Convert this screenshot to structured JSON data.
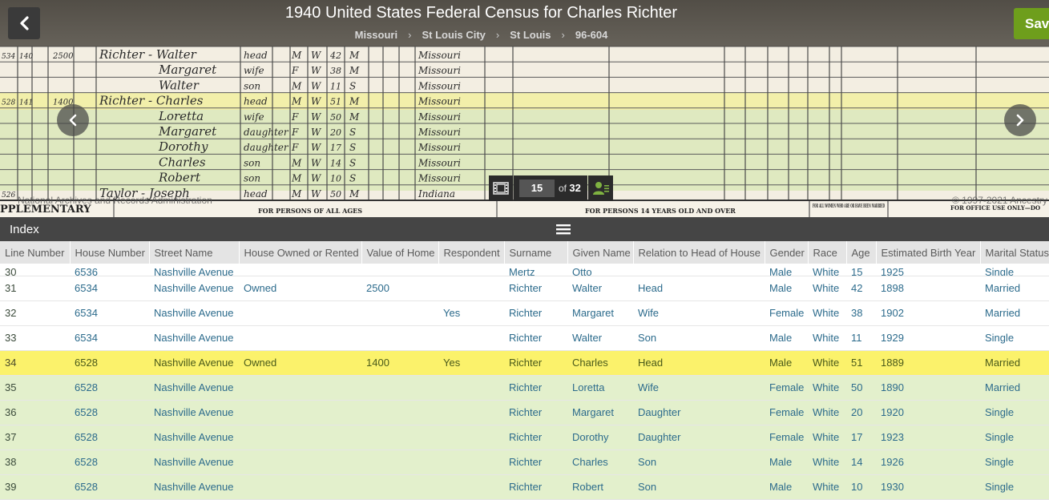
{
  "header": {
    "title": "1940 United States Federal Census for Charles Richter",
    "breadcrumbs": [
      "Missouri",
      "St Louis City",
      "St Louis",
      "96-604"
    ],
    "save_label": "Save"
  },
  "viewer": {
    "credit_left": "National Archives and Records Administration",
    "credit_right": "© 1997-2021 Ancestry",
    "page_current": "15",
    "page_total_prefix": "of",
    "page_total": "32",
    "sheet_captions": [
      "PPLEMENTARY",
      "FOR PERSONS OF ALL AGES",
      "FOR PERSONS 14 YEARS OLD AND OVER",
      "FOR ALL WOMEN WHO ARE OR HAVE BEEN MARRIED",
      "FOR OFFICE USE ONLY—DO"
    ],
    "handwriting": [
      {
        "line": "534",
        "serial": "140",
        "value": "2500",
        "name": "Richter - Walter",
        "rel": "head",
        "sex": "M",
        "race": "W",
        "age": "42",
        "ms": "M",
        "place": "Missouri"
      },
      {
        "line": "",
        "serial": "",
        "value": "",
        "name": "Margaret",
        "rel": "wife",
        "sex": "F",
        "race": "W",
        "age": "38",
        "ms": "M",
        "place": "Missouri"
      },
      {
        "line": "",
        "serial": "",
        "value": "",
        "name": "Walter",
        "rel": "son",
        "sex": "M",
        "race": "W",
        "age": "11",
        "ms": "S",
        "place": "Missouri"
      },
      {
        "line": "528",
        "serial": "141",
        "value": "1400",
        "name": "Richter - Charles",
        "rel": "head",
        "sex": "M",
        "race": "W",
        "age": "51",
        "ms": "M",
        "place": "Missouri"
      },
      {
        "line": "",
        "serial": "",
        "value": "",
        "name": "Loretta",
        "rel": "wife",
        "sex": "F",
        "race": "W",
        "age": "50",
        "ms": "M",
        "place": "Missouri"
      },
      {
        "line": "",
        "serial": "",
        "value": "",
        "name": "Margaret",
        "rel": "daughter",
        "sex": "F",
        "race": "W",
        "age": "20",
        "ms": "S",
        "place": "Missouri"
      },
      {
        "line": "",
        "serial": "",
        "value": "",
        "name": "Dorothy",
        "rel": "daughter",
        "sex": "F",
        "race": "W",
        "age": "17",
        "ms": "S",
        "place": "Missouri"
      },
      {
        "line": "",
        "serial": "",
        "value": "",
        "name": "Charles",
        "rel": "son",
        "sex": "M",
        "race": "W",
        "age": "14",
        "ms": "S",
        "place": "Missouri"
      },
      {
        "line": "",
        "serial": "",
        "value": "",
        "name": "Robert",
        "rel": "son",
        "sex": "M",
        "race": "W",
        "age": "10",
        "ms": "S",
        "place": "Missouri"
      },
      {
        "line": "526",
        "serial": "",
        "value": "",
        "name": "Taylor - Joseph",
        "rel": "head",
        "sex": "M",
        "race": "W",
        "age": "50",
        "ms": "M",
        "place": "Indiana"
      }
    ]
  },
  "index": {
    "title": "Index",
    "columns": [
      "Line Number",
      "House Number",
      "Street Name",
      "House Owned or Rented",
      "Value of Home",
      "Respondent",
      "Surname",
      "Given Name",
      "Relation to Head of House",
      "Gender",
      "Race",
      "Age",
      "Estimated Birth Year",
      "Marital Status"
    ],
    "partial_row": [
      "30",
      "6536",
      "Nashville Avenue",
      "",
      "",
      "",
      "Mertz",
      "Otto",
      "",
      "Male",
      "White",
      "15",
      "1925",
      "Single"
    ],
    "rows": [
      [
        "31",
        "6534",
        "Nashville Avenue",
        "Owned",
        "2500",
        "",
        "Richter",
        "Walter",
        "Head",
        "Male",
        "White",
        "42",
        "1898",
        "Married"
      ],
      [
        "32",
        "6534",
        "Nashville Avenue",
        "",
        "",
        "Yes",
        "Richter",
        "Margaret",
        "Wife",
        "Female",
        "White",
        "38",
        "1902",
        "Married"
      ],
      [
        "33",
        "6534",
        "Nashville Avenue",
        "",
        "",
        "",
        "Richter",
        "Walter",
        "Son",
        "Male",
        "White",
        "11",
        "1929",
        "Single"
      ],
      [
        "34",
        "6528",
        "Nashville Avenue",
        "Owned",
        "1400",
        "Yes",
        "Richter",
        "Charles",
        "Head",
        "Male",
        "White",
        "51",
        "1889",
        "Married"
      ],
      [
        "35",
        "6528",
        "Nashville Avenue",
        "",
        "",
        "",
        "Richter",
        "Loretta",
        "Wife",
        "Female",
        "White",
        "50",
        "1890",
        "Married"
      ],
      [
        "36",
        "6528",
        "Nashville Avenue",
        "",
        "",
        "",
        "Richter",
        "Margaret",
        "Daughter",
        "Female",
        "White",
        "20",
        "1920",
        "Single"
      ],
      [
        "37",
        "6528",
        "Nashville Avenue",
        "",
        "",
        "",
        "Richter",
        "Dorothy",
        "Daughter",
        "Female",
        "White",
        "17",
        "1923",
        "Single"
      ],
      [
        "38",
        "6528",
        "Nashville Avenue",
        "",
        "",
        "",
        "Richter",
        "Charles",
        "Son",
        "Male",
        "White",
        "14",
        "1926",
        "Single"
      ],
      [
        "39",
        "6528",
        "Nashville Avenue",
        "",
        "",
        "",
        "Richter",
        "Robert",
        "Son",
        "Male",
        "White",
        "10",
        "1930",
        "Single"
      ]
    ],
    "highlight_row": 3,
    "family_rows": [
      4,
      5,
      6,
      7,
      8
    ],
    "colors": {
      "highlight": "#fbf26b",
      "family": "#e3f0cc",
      "link": "#2c6b8c",
      "save": "#6e9e1c"
    }
  }
}
